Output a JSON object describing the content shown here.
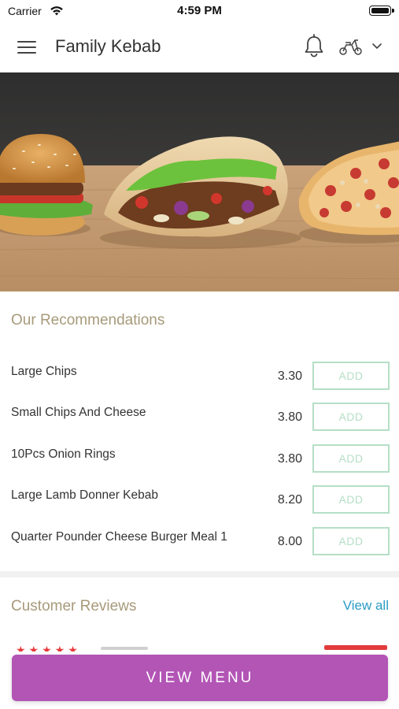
{
  "status_bar": {
    "carrier": "Carrier",
    "time": "4:59 PM"
  },
  "header": {
    "title": "Family Kebab",
    "icons": [
      "menu-icon",
      "bell-icon",
      "scooter-icon",
      "chevron-down-icon"
    ]
  },
  "recommendations": {
    "title": "Our Recommendations",
    "items": [
      {
        "name": "Large Chips",
        "price": "3.30",
        "button": "ADD"
      },
      {
        "name": "Small Chips And Cheese",
        "price": "3.80",
        "button": "ADD"
      },
      {
        "name": "10Pcs Onion Rings",
        "price": "3.80",
        "button": "ADD"
      },
      {
        "name": "Large Lamb Donner Kebab",
        "price": "8.20",
        "button": "ADD"
      },
      {
        "name": "Quarter Pounder Cheese Burger Meal 1",
        "price": "8.00",
        "button": "ADD"
      }
    ]
  },
  "reviews": {
    "title": "Customer Reviews",
    "view_all": "View all"
  },
  "footer": {
    "view_menu": "VIEW MENU"
  },
  "colors": {
    "accent_purple": "#b255b5",
    "section_title": "#a79a7a",
    "add_button": "#b5dfc6",
    "link_blue": "#2a9bc4",
    "star_red": "#e83a3a"
  }
}
